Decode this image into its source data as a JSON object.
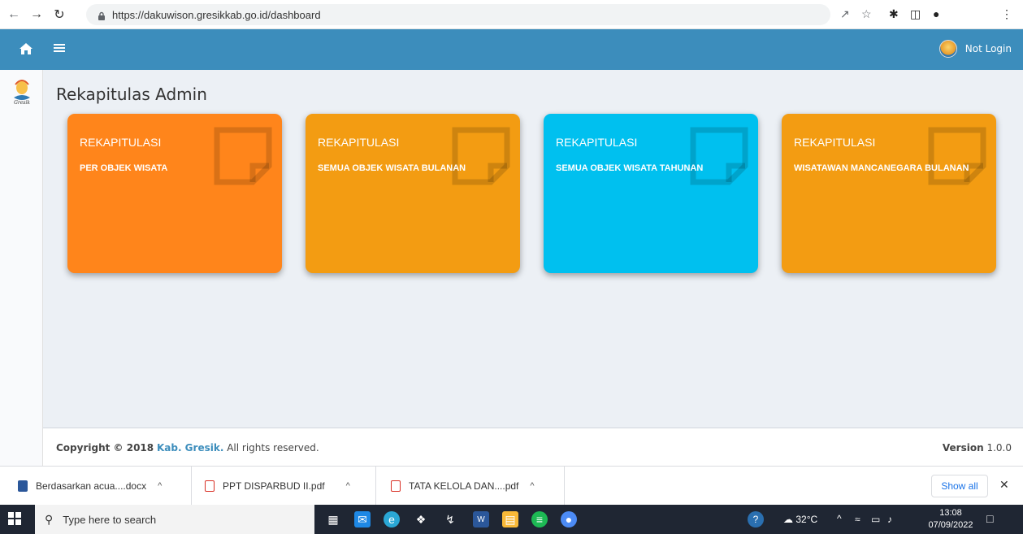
{
  "browser": {
    "url": "https://dakuwison.gresikkab.go.id/dashboard",
    "back_icon": "back-arrow",
    "forward_icon": "forward-arrow",
    "reload_icon": "reload"
  },
  "header": {
    "user_label": "Not Login",
    "color": "#3c8dbc"
  },
  "main": {
    "title": "Rekapitulas Admin",
    "cards": [
      {
        "title": "REKAPITULASI",
        "subtitle": "PER OBJEK WISATA",
        "color": "#ff851b"
      },
      {
        "title": "REKAPITULASI",
        "subtitle": "SEMUA OBJEK WISATA BULANAN",
        "color": "#f39c12"
      },
      {
        "title": "REKAPITULASI",
        "subtitle": "SEMUA OBJEK WISATA TAHUNAN",
        "color": "#00c0ef"
      },
      {
        "title": "REKAPITULASI",
        "subtitle": "WISATAWAN MANCANEGARA BULANAN",
        "color": "#f39c12"
      }
    ]
  },
  "footer": {
    "copyright_prefix": "Copyright © 2018",
    "brand": "Kab. Gresik.",
    "copyright_suffix": "All rights reserved.",
    "version_label": "Version",
    "version_value": "1.0.0"
  },
  "downloads": {
    "items": [
      {
        "name": "Berdasarkan acua....docx"
      },
      {
        "name": "PPT DISPARBUD II.pdf"
      },
      {
        "name": "TATA KELOLA DAN....pdf"
      }
    ],
    "show_all": "Show all"
  },
  "taskbar": {
    "search_placeholder": "Type here to search",
    "temperature": "32°C",
    "time": "13:08",
    "date": "07/09/2022"
  }
}
